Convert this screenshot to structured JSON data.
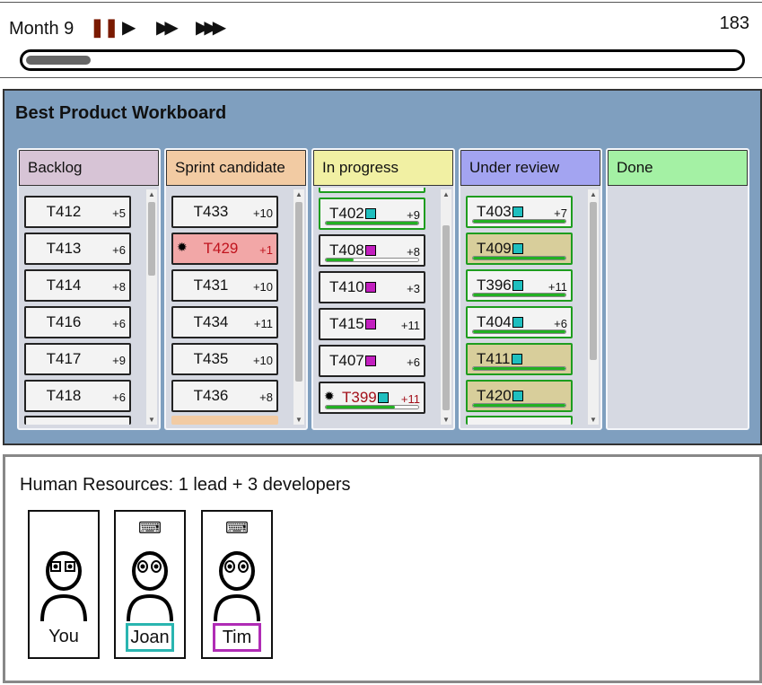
{
  "topbar": {
    "month": "Month 9",
    "controls": {
      "pause": "❚❚",
      "play": "▶",
      "fast": "▶▶",
      "faster": "▶▶▶"
    },
    "money": "183",
    "progress": 0.09
  },
  "board": {
    "title": "Best Product Workboard",
    "columns": [
      {
        "title": "Backlog",
        "color": "#d7c4d6"
      },
      {
        "title": "Sprint candidate",
        "color": "#f2cba3"
      },
      {
        "title": "In progress",
        "color": "#f1f0a3"
      },
      {
        "title": "Under review",
        "color": "#a3a4f1"
      },
      {
        "title": "Done",
        "color": "#a4f1a4"
      }
    ],
    "backlog": [
      {
        "id": "T412",
        "points": "+5"
      },
      {
        "id": "T413",
        "points": "+6"
      },
      {
        "id": "T414",
        "points": "+8"
      },
      {
        "id": "T416",
        "points": "+6"
      },
      {
        "id": "T417",
        "points": "+9"
      },
      {
        "id": "T418",
        "points": "+6"
      }
    ],
    "sprint": [
      {
        "id": "T433",
        "points": "+10"
      },
      {
        "id": "T429",
        "points": "+1",
        "bug": true
      },
      {
        "id": "T431",
        "points": "+10"
      },
      {
        "id": "T434",
        "points": "+11"
      },
      {
        "id": "T435",
        "points": "+10"
      },
      {
        "id": "T436",
        "points": "+8"
      }
    ],
    "in_progress": [
      {
        "id": "T402",
        "points": "+9",
        "dev": "joan",
        "progress": 1.0,
        "green": true
      },
      {
        "id": "T408",
        "points": "+8",
        "dev": "tim",
        "progress": 0.3
      },
      {
        "id": "T410",
        "points": "+3",
        "dev": "tim"
      },
      {
        "id": "T415",
        "points": "+11",
        "dev": "tim"
      },
      {
        "id": "T407",
        "points": "+6",
        "dev": "tim"
      },
      {
        "id": "T399",
        "points": "+11",
        "dev": "joan",
        "progress": 0.75,
        "bug": true
      }
    ],
    "review": [
      {
        "id": "T403",
        "points": "+7",
        "dev": "joan",
        "progress": 1.0
      },
      {
        "id": "T409",
        "points": "",
        "dev": "joan",
        "progress": 1.0,
        "reviewing": true
      },
      {
        "id": "T396",
        "points": "+11",
        "dev": "joan",
        "progress": 1.0
      },
      {
        "id": "T404",
        "points": "+6",
        "dev": "joan",
        "progress": 1.0
      },
      {
        "id": "T411",
        "points": "",
        "dev": "joan",
        "progress": 1.0,
        "reviewing": true
      },
      {
        "id": "T420",
        "points": "",
        "dev": "joan",
        "progress": 1.0,
        "reviewing": true
      }
    ]
  },
  "hr": {
    "title": "Human Resources: 1 lead + 3 developers",
    "people": [
      {
        "name": "You",
        "keyboard": "",
        "color": ""
      },
      {
        "name": "Joan",
        "keyboard": "⌨",
        "color": "#2ab5b0"
      },
      {
        "name": "Tim",
        "keyboard": "⌨",
        "color": "#b02cb5"
      }
    ]
  },
  "dev_colors": {
    "joan": "#1fbfbf",
    "tim": "#c21fbf"
  },
  "icons": {
    "bug": "bug-icon",
    "keyboard": "keyboard-icon",
    "pause": "pause-icon",
    "play": "play-icon"
  }
}
